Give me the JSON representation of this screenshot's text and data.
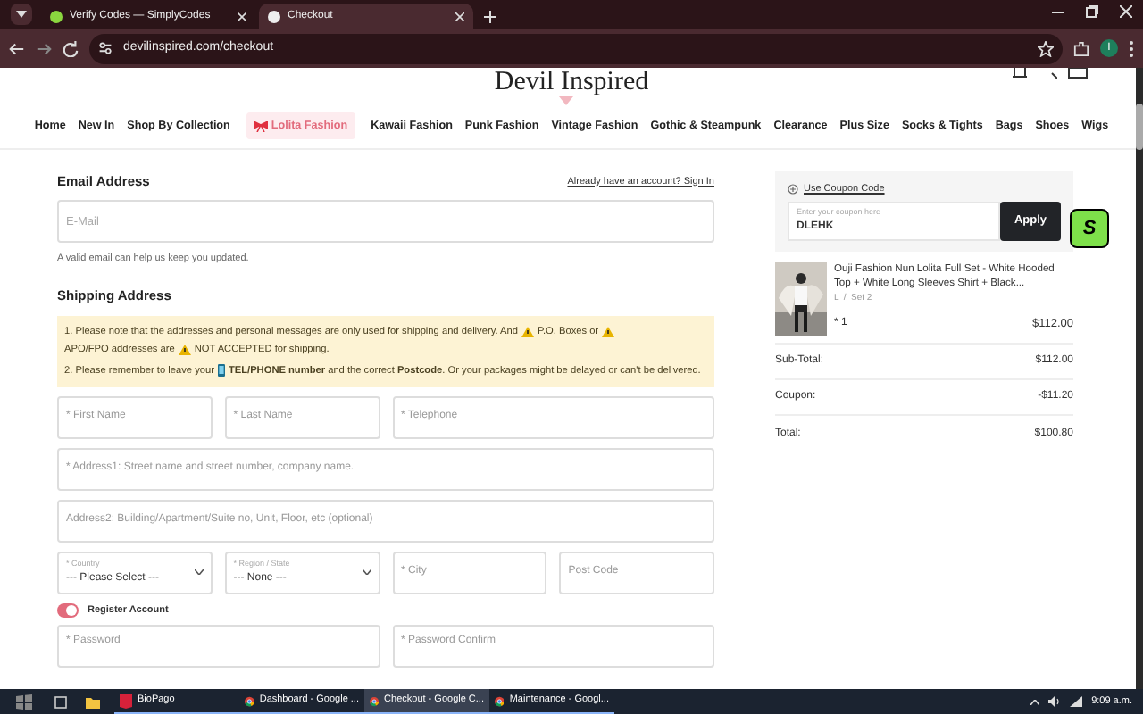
{
  "browser": {
    "tabs": [
      {
        "title": "Verify Codes — SimplyCodes",
        "selected": false
      },
      {
        "title": "Checkout",
        "selected": true
      }
    ],
    "url": "devilinspired.com/checkout",
    "profile": "I"
  },
  "site": {
    "logo": "Devil Inspired",
    "nav": [
      {
        "label": "Home",
        "selected": false
      },
      {
        "label": "New In",
        "selected": false
      },
      {
        "label": "Shop By Collection",
        "selected": false
      },
      {
        "label": "Lolita Fashion",
        "selected": true
      },
      {
        "label": "Kawaii Fashion",
        "selected": false
      },
      {
        "label": "Punk Fashion",
        "selected": false
      },
      {
        "label": "Vintage Fashion",
        "selected": false
      },
      {
        "label": "Gothic & Steampunk",
        "selected": false
      },
      {
        "label": "Clearance",
        "selected": false
      },
      {
        "label": "Plus Size",
        "selected": false
      },
      {
        "label": "Socks & Tights",
        "selected": false
      },
      {
        "label": "Bags",
        "selected": false
      },
      {
        "label": "Shoes",
        "selected": false
      },
      {
        "label": "Wigs",
        "selected": false
      }
    ]
  },
  "email": {
    "heading": "Email Address",
    "sign_in_link": "Already have an account? Sign In",
    "placeholder": "E-Mail",
    "hint": "A valid email can help us keep you updated."
  },
  "shipping": {
    "heading": "Shipping Address",
    "notice": [
      [
        {
          "kind": "text",
          "text": "1. Please note that the addresses and personal messages are only used for shipping and delivery. And"
        },
        {
          "kind": "warning"
        },
        {
          "kind": "text",
          "text": "P.O. Boxes or"
        },
        {
          "kind": "warning"
        },
        {
          "kind": "text",
          "text": "APO/FPO addresses are"
        },
        {
          "kind": "warning"
        },
        {
          "kind": "text",
          "text": "NOT ACCEPTED for shipping."
        }
      ],
      [
        {
          "kind": "text",
          "text": "2. Please remember to leave your"
        },
        {
          "kind": "phone"
        },
        {
          "kind": "text",
          "text": "**TEL/PHONE number** and the correct **Postcode**. Or your packages might be delayed or can't be delivered."
        }
      ]
    ],
    "rows": [
      [
        {
          "kind": "input",
          "placeholder": "* First Name"
        },
        {
          "kind": "input",
          "placeholder": "* Last Name"
        },
        {
          "kind": "input",
          "placeholder": "* Telephone"
        }
      ],
      [
        {
          "kind": "input",
          "placeholder": "* Address1: Street name and street number, company name."
        }
      ],
      [
        {
          "kind": "input",
          "placeholder": "Address2: Building/Apartment/Suite no, Unit, Floor, etc (optional)"
        }
      ],
      [
        {
          "kind": "select",
          "label": "* Country",
          "value": "--- Please Select ---"
        },
        {
          "kind": "select",
          "label": "* Region / State",
          "value": "--- None ---"
        },
        {
          "kind": "input",
          "placeholder": "* City"
        },
        {
          "kind": "input",
          "placeholder": "Post Code"
        }
      ]
    ],
    "register": {
      "label": "Register Account",
      "on": true
    },
    "password_row": [
      {
        "placeholder": "* Password"
      },
      {
        "placeholder": "* Password Confirm"
      }
    ]
  },
  "summary": {
    "coupon_link": "Use Coupon Code",
    "coupon_label": "Enter your coupon here",
    "coupon_value": "DLEHK",
    "apply": "Apply",
    "item": {
      "name": "Ouji Fashion Nun Lolita Full Set - White Hooded Top + White Long Sleeves Shirt + Black...",
      "variant": "L  /  Set 2",
      "qty": "* 1",
      "price": "$112.00"
    },
    "totals": [
      {
        "label": "Sub-Total:",
        "value": "$112.00"
      },
      {
        "label": "Coupon:",
        "value": "-$11.20"
      },
      {
        "label": "Total:",
        "value": "$100.80"
      }
    ]
  },
  "extension_badge": "S",
  "taskbar": {
    "apps": [
      {
        "title": "BioPago",
        "kind": "biopago",
        "selected": false
      },
      {
        "title": "Dashboard - Google ...",
        "kind": "chrome",
        "selected": false
      },
      {
        "title": "Checkout - Google C...",
        "kind": "chrome",
        "selected": true
      },
      {
        "title": "Maintenance - Googl...",
        "kind": "chrome",
        "selected": false
      }
    ],
    "time": "9:09 a.m."
  }
}
